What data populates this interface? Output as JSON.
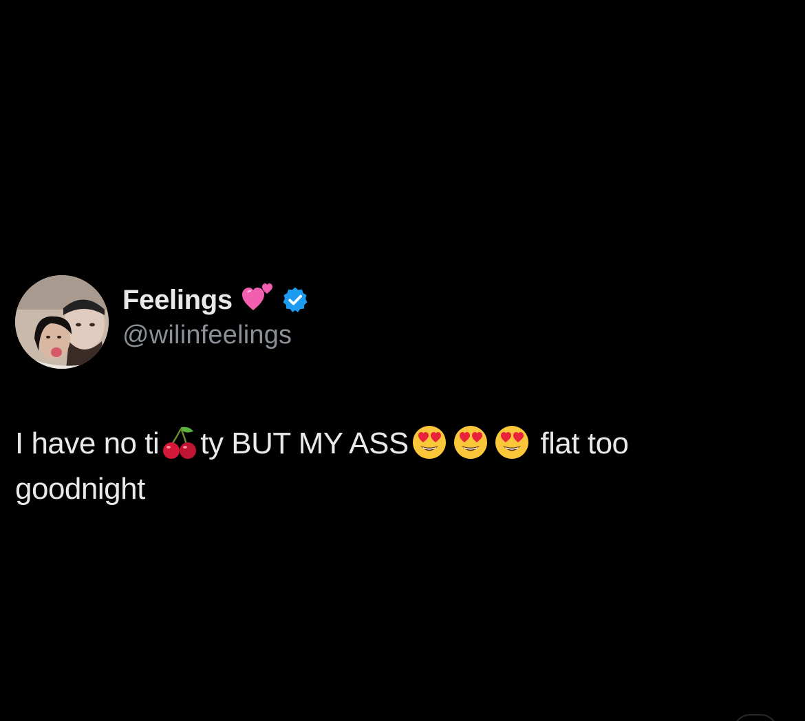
{
  "tweet": {
    "author": {
      "display_name": "Feelings",
      "name_emoji": "two-hearts-emoji",
      "verified": true,
      "verified_icon": "verified-badge-icon",
      "handle": "@wilinfeelings",
      "avatar": "profile-photo-avatar"
    },
    "text_parts": {
      "part1": "I have no ti",
      "emoji1": "cherries-emoji",
      "part2": "ty BUT MY ASS",
      "emoji2": "heart-eyes-emoji",
      "emoji3": "heart-eyes-emoji",
      "emoji4": "heart-eyes-emoji",
      "part3": " flat too",
      "part4": "goodnight"
    }
  },
  "colors": {
    "background": "#000000",
    "name": "#e7e9ea",
    "handle": "#8b9096",
    "verified": "#1d9bf0",
    "heart": "#f25fb0"
  }
}
